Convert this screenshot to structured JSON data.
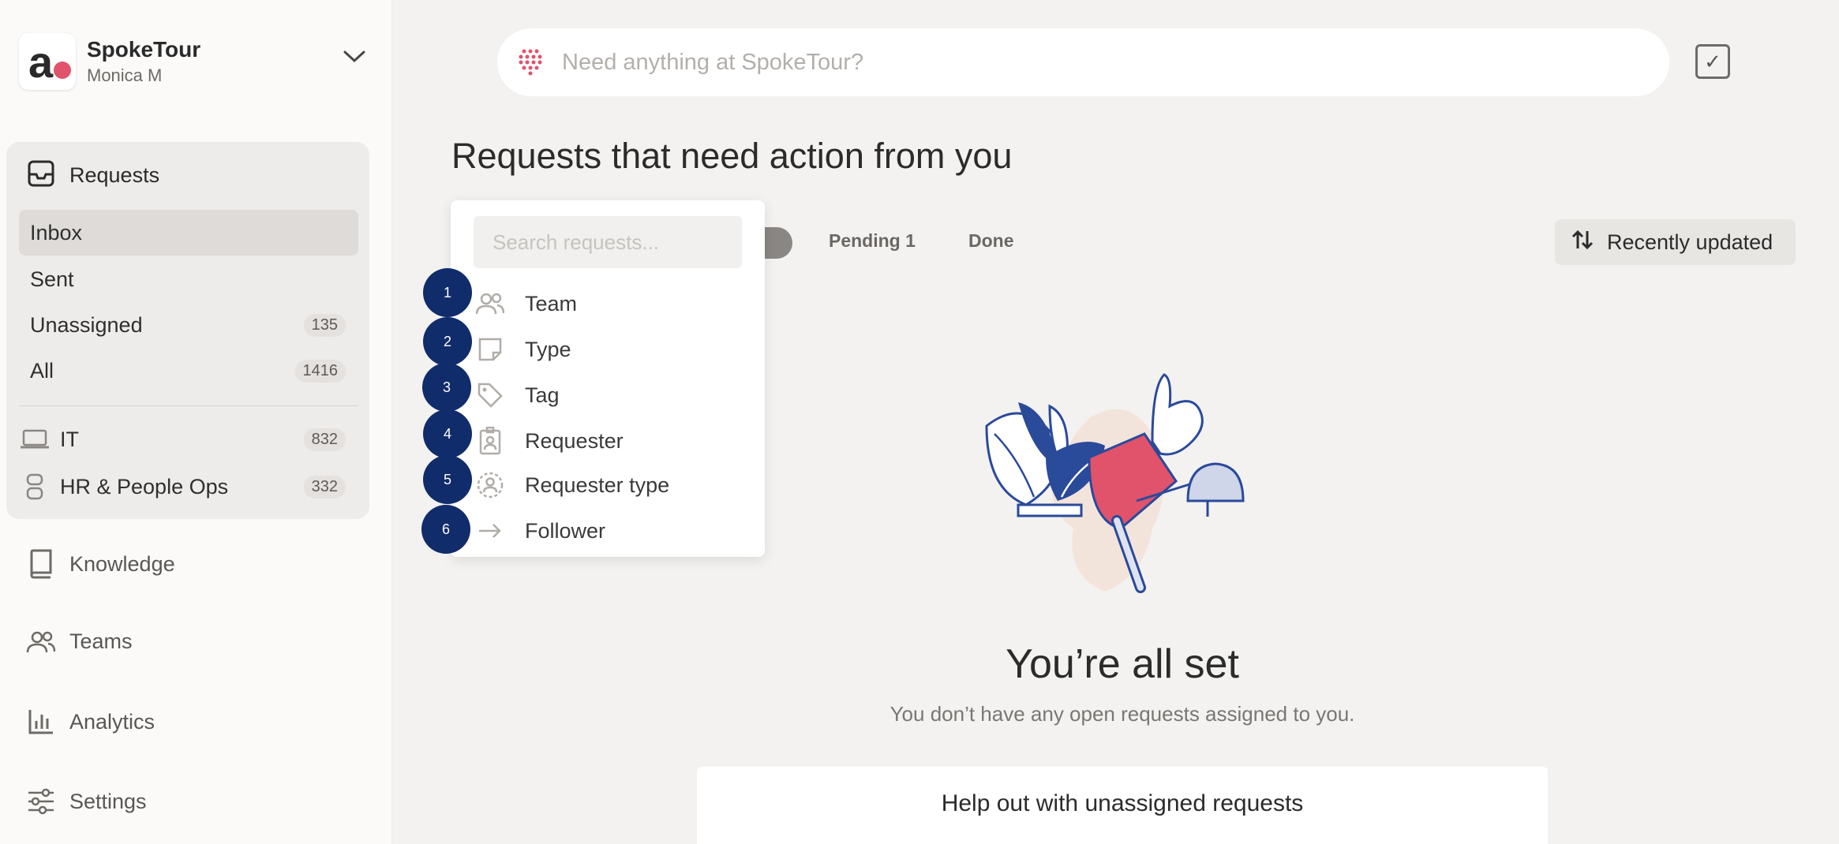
{
  "org": {
    "name": "SpokeTour",
    "user": "Monica M",
    "logo_letter": "a"
  },
  "sidebar": {
    "requests_label": "Requests",
    "items": [
      {
        "label": "Inbox",
        "count": ""
      },
      {
        "label": "Sent",
        "count": ""
      },
      {
        "label": "Unassigned",
        "count": "135"
      },
      {
        "label": "All",
        "count": "1416"
      }
    ],
    "teams": [
      {
        "label": "IT",
        "count": "832"
      },
      {
        "label": "HR & People Ops",
        "count": "332"
      }
    ],
    "links": [
      {
        "label": "Knowledge"
      },
      {
        "label": "Teams"
      },
      {
        "label": "Analytics"
      },
      {
        "label": "Settings"
      }
    ]
  },
  "search": {
    "placeholder": "Need anything at SpokeTour?"
  },
  "main": {
    "title": "Requests that need action from you",
    "tabs": {
      "pending": "Pending 1",
      "done": "Done"
    },
    "sort_label": "Recently updated"
  },
  "dropdown": {
    "search_placeholder": "Search requests...",
    "items": [
      {
        "marker": "1",
        "label": "Team",
        "icon": "people-icon"
      },
      {
        "marker": "2",
        "label": "Type",
        "icon": "note-icon"
      },
      {
        "marker": "3",
        "label": "Tag",
        "icon": "tag-icon"
      },
      {
        "marker": "4",
        "label": "Requester",
        "icon": "badge-icon"
      },
      {
        "marker": "5",
        "label": "Requester type",
        "icon": "user-circle-icon"
      },
      {
        "marker": "6",
        "label": "Follower",
        "icon": "arrow-right-icon"
      }
    ]
  },
  "empty": {
    "title": "You’re all set",
    "subtitle": "You don’t have any open requests assigned to you."
  },
  "help": {
    "title": "Help out with unassigned requests"
  },
  "colors": {
    "accent": "#e0536b",
    "marker": "#112c6b",
    "navy": "#2a4a9a"
  }
}
